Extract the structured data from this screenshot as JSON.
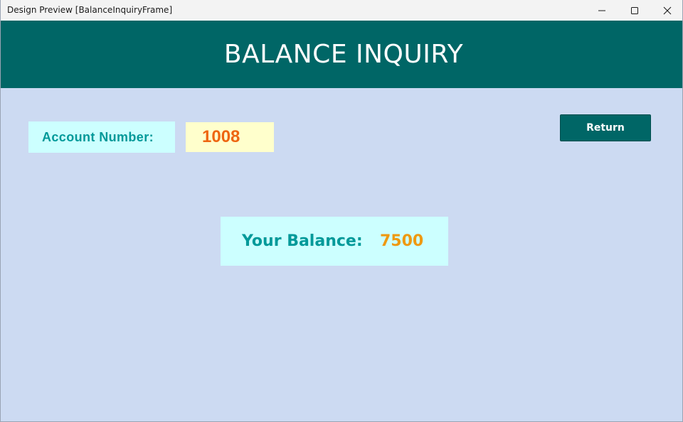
{
  "window": {
    "title": "Design Preview [BalanceInquiryFrame]"
  },
  "header": {
    "title": "BALANCE INQUIRY"
  },
  "account": {
    "label": "Account Number:",
    "value": "1008"
  },
  "actions": {
    "return_label": "Return"
  },
  "balance": {
    "label": "Your Balance:",
    "value": "7500"
  },
  "colors": {
    "background": "#ccdaf2",
    "header": "#006666",
    "label_box": "#ccffff",
    "value_box": "#ffffcc",
    "label_text": "#009999",
    "account_value_text": "#ee6611",
    "balance_value_text": "#ee9911"
  },
  "icons": {
    "minimize": "minimize-icon",
    "maximize": "maximize-icon",
    "close": "close-icon"
  }
}
